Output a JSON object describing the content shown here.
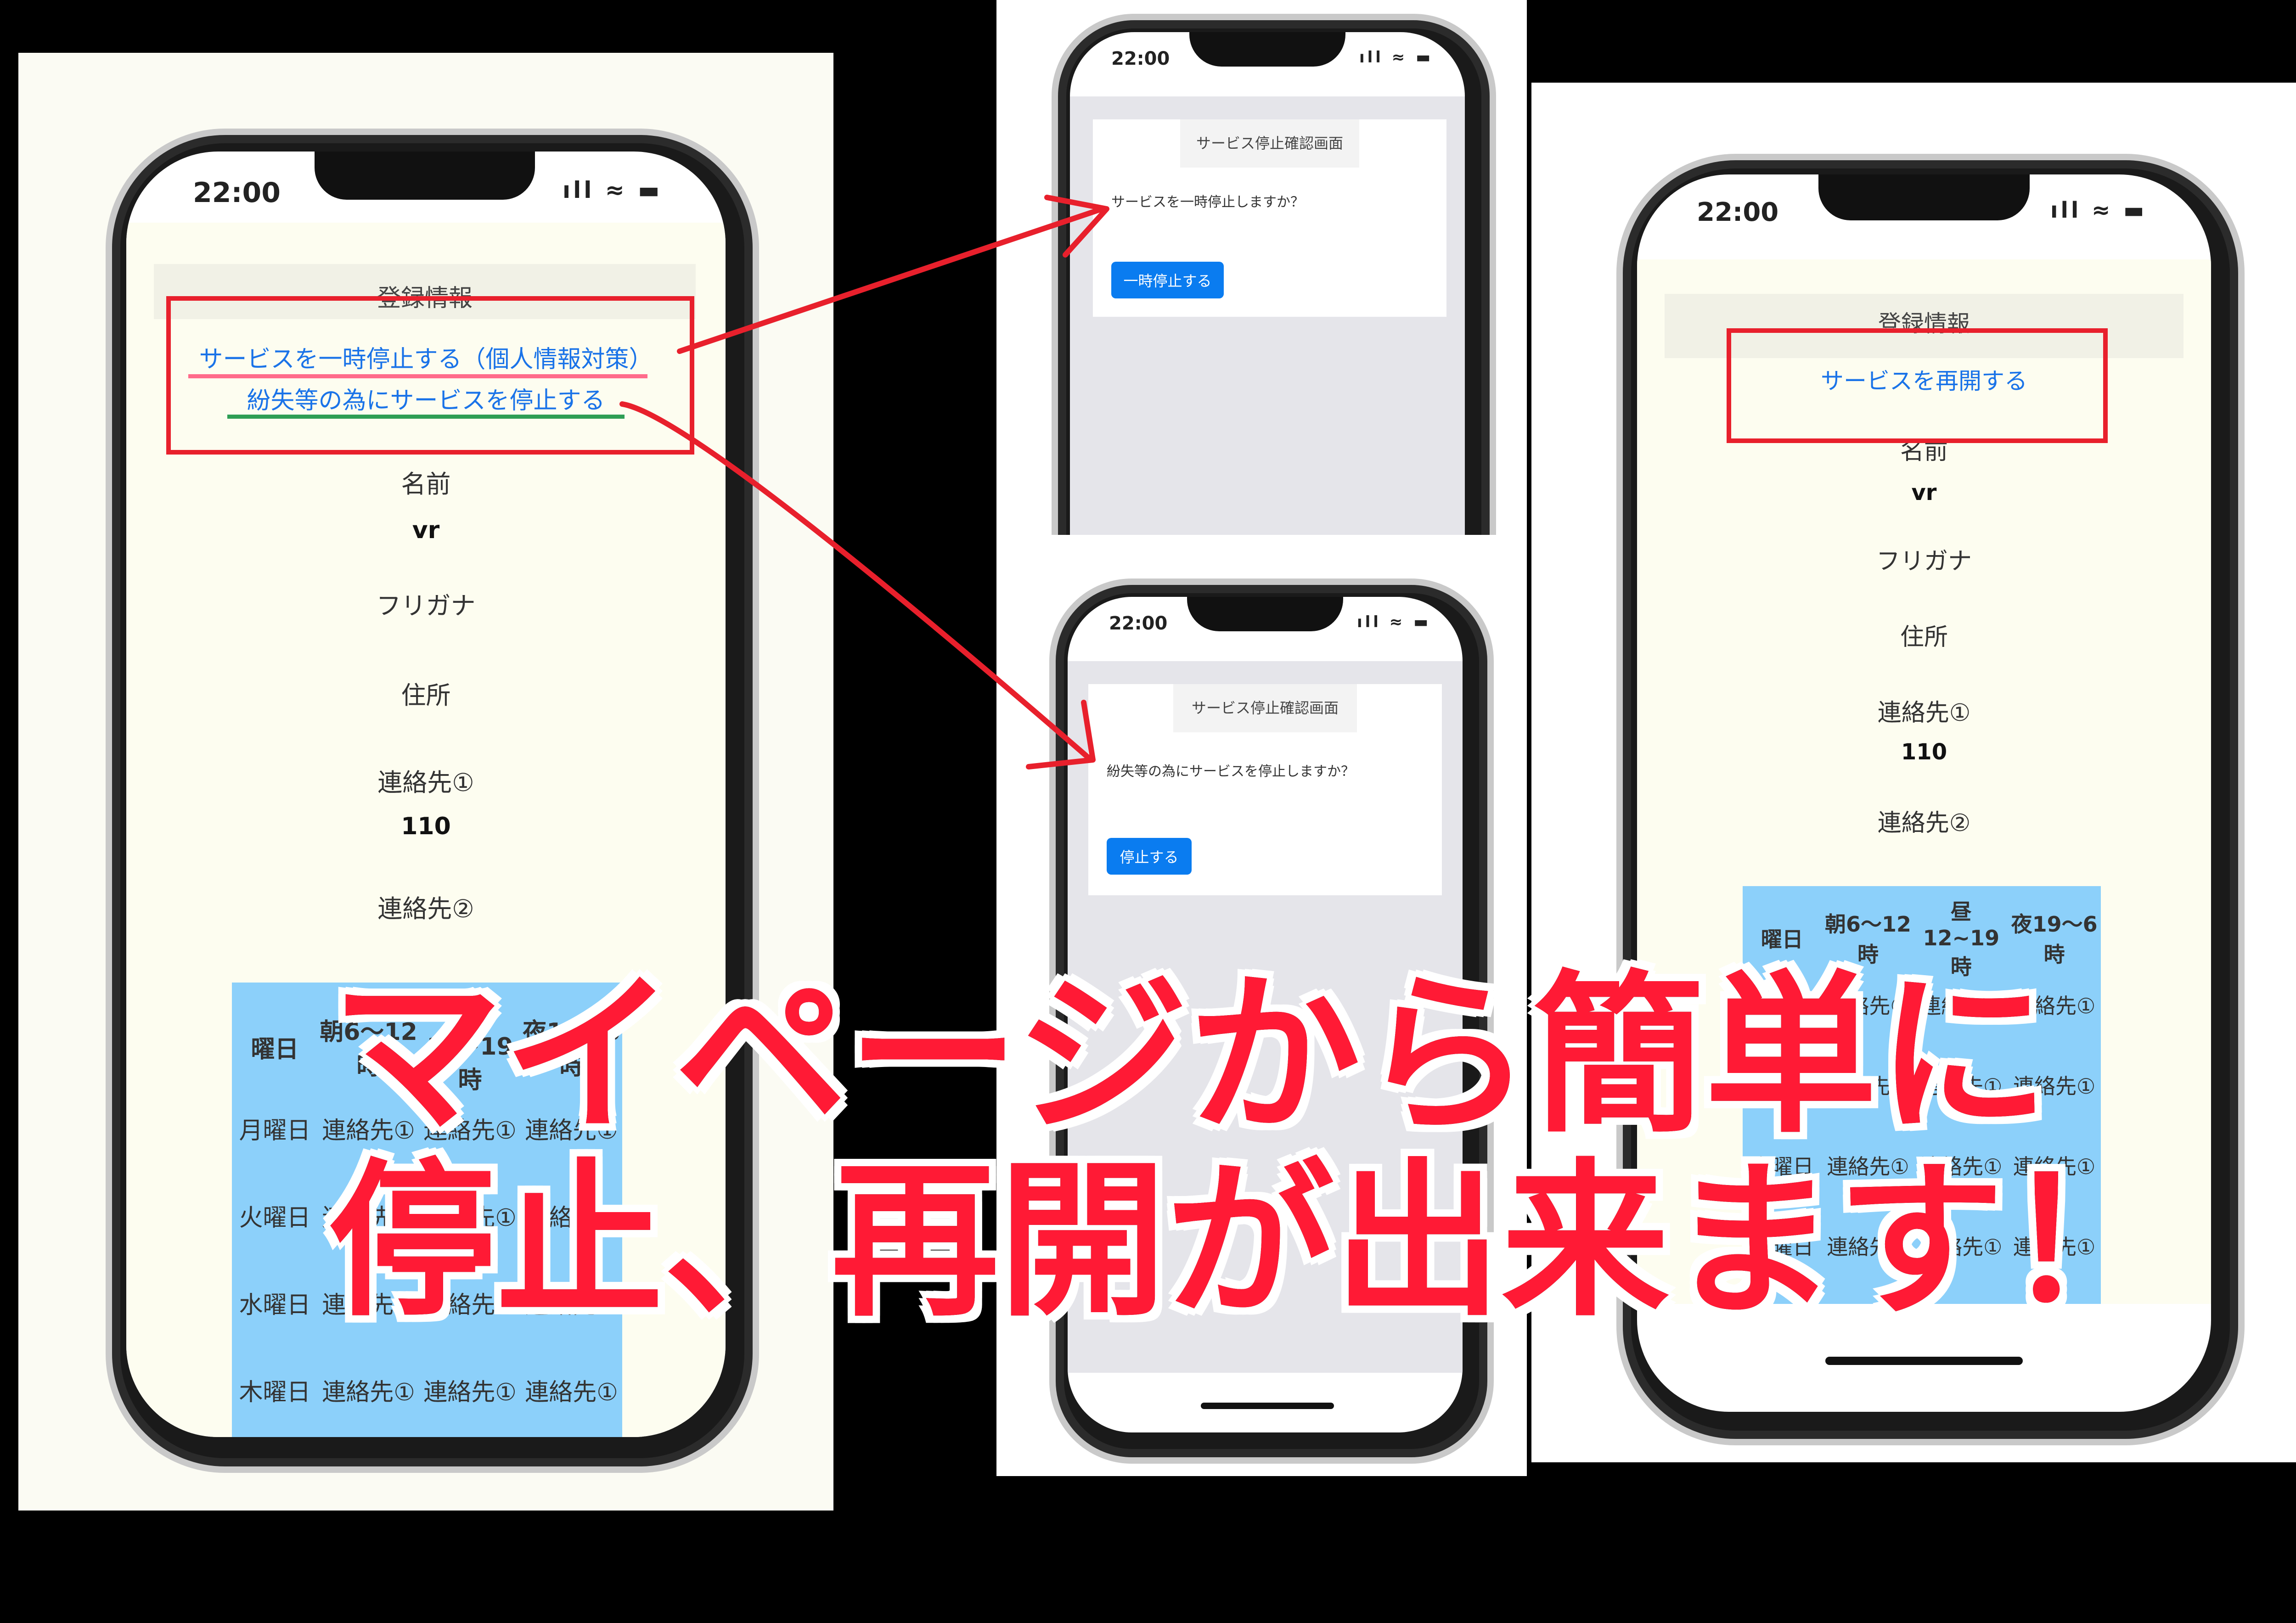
{
  "status_time": "22:00",
  "status_icons": "ıll ≈ ▬",
  "phone1": {
    "header": "登録情報",
    "links": [
      "サービスを一時停止する（個人情報対策）",
      "紛失等の為にサービスを停止する"
    ],
    "fields": [
      {
        "label": "名前",
        "value": "vr"
      },
      {
        "label": "フリガナ",
        "value": ""
      },
      {
        "label": "住所",
        "value": ""
      },
      {
        "label": "連絡先①",
        "value": "110"
      },
      {
        "label": "連絡先②",
        "value": ""
      }
    ],
    "schedule": {
      "headers": [
        "曜日",
        "朝6～12時",
        "昼12~19時",
        "夜19～6時"
      ],
      "rows": [
        [
          "月曜日",
          "連絡先①",
          "連絡先①",
          "連絡先①"
        ],
        [
          "火曜日",
          "連絡先①",
          "連絡先①",
          "連絡先①"
        ],
        [
          "水曜日",
          "連絡先①",
          "連絡先①",
          "連絡先①"
        ],
        [
          "木曜日",
          "連絡先①",
          "連絡先①",
          "連絡先①"
        ]
      ]
    }
  },
  "phone2": {
    "card_title": "サービス停止確認画面",
    "message": "サービスを一時停止しますか？",
    "button": "一時停止する"
  },
  "phone3": {
    "card_title": "サービス停止確認画面",
    "message": "紛失等の為にサービスを停止しますか？",
    "button": "停止する"
  },
  "phone4": {
    "header": "登録情報",
    "link": "サービスを再開する",
    "fields": [
      {
        "label": "名前",
        "value": "vr"
      },
      {
        "label": "フリガナ",
        "value": ""
      },
      {
        "label": "住所",
        "value": ""
      },
      {
        "label": "連絡先①",
        "value": "110"
      },
      {
        "label": "連絡先②",
        "value": ""
      }
    ],
    "schedule": {
      "headers": [
        "曜日",
        "朝6～12時",
        "昼12~19時",
        "夜19～6時"
      ],
      "rows": [
        [
          "月曜日",
          "連絡先①",
          "連絡先①",
          "連絡先①"
        ],
        [
          "火曜日",
          "連絡先①",
          "連絡先①",
          "連絡先①"
        ],
        [
          "水曜日",
          "連絡先①",
          "連絡先①",
          "連絡先①"
        ],
        [
          "木曜日",
          "連絡先①",
          "連絡先①",
          "連絡先①"
        ]
      ]
    }
  },
  "overlay": {
    "line1": "マイページから簡単に",
    "line2": "停止、再開が出来ます！"
  },
  "colors": {
    "accent_red": "#e8202c",
    "link_blue": "#1a73e8",
    "button_blue": "#0a7cf0",
    "schedule_bg": "#8cd0fa"
  }
}
